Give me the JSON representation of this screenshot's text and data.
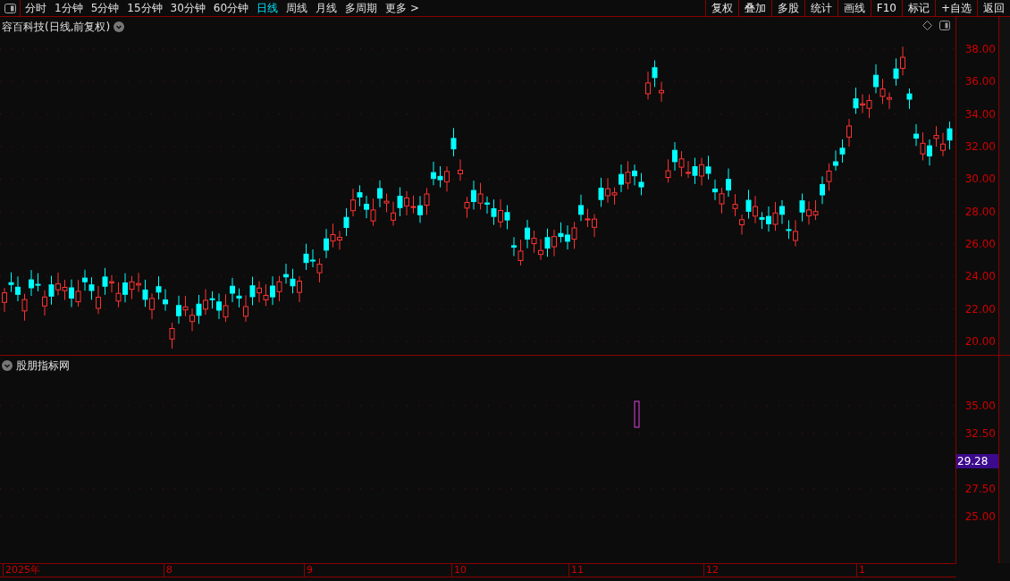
{
  "toolbar": {
    "periods": [
      {
        "label": "分时",
        "selected": false
      },
      {
        "label": "1分钟",
        "selected": false
      },
      {
        "label": "5分钟",
        "selected": false
      },
      {
        "label": "15分钟",
        "selected": false
      },
      {
        "label": "30分钟",
        "selected": false
      },
      {
        "label": "60分钟",
        "selected": false
      },
      {
        "label": "日线",
        "selected": true
      },
      {
        "label": "周线",
        "selected": false
      },
      {
        "label": "月线",
        "selected": false
      },
      {
        "label": "多周期",
        "selected": false
      },
      {
        "label": "更多 >",
        "selected": false
      }
    ],
    "buttons": [
      "复权",
      "叠加",
      "多股",
      "统计",
      "画线",
      "F10",
      "标记",
      "+自选",
      "返回"
    ]
  },
  "main_panel": {
    "title": "容百科技(日线,前复权)",
    "yticks": [
      "38.00",
      "36.00",
      "34.00",
      "32.00",
      "30.00",
      "28.00",
      "26.00",
      "24.00",
      "22.00",
      "20.00"
    ]
  },
  "indicator_panel": {
    "title": "股朋指标网",
    "yticks": [
      "35.00",
      "32.50",
      "27.50",
      "25.00"
    ],
    "current_value": "29.28"
  },
  "date_axis": [
    "2025年",
    "8",
    "9",
    "10",
    "11",
    "12",
    "1"
  ]
}
